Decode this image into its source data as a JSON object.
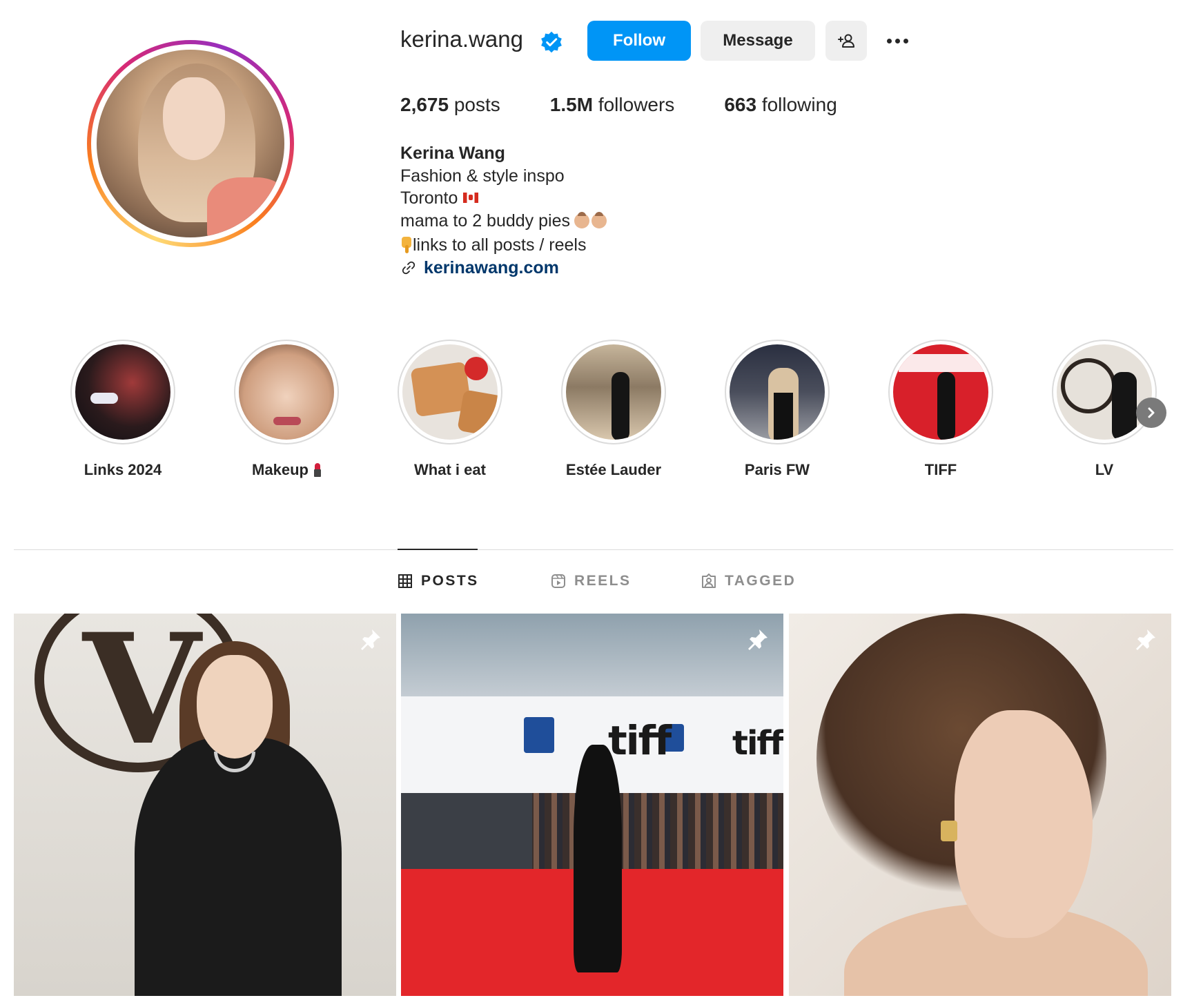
{
  "profile": {
    "username": "kerina.wang",
    "verified_icon": "verified-badge-icon",
    "actions": {
      "follow_label": "Follow",
      "message_label": "Message",
      "add_user_icon": "person-add-icon",
      "more_icon": "more-options-icon"
    },
    "stats": {
      "posts_count": "2,675",
      "posts_label": "posts",
      "followers_count": "1.5M",
      "followers_label": "followers",
      "following_count": "663",
      "following_label": "following"
    },
    "bio": {
      "name": "Kerina Wang",
      "line1": "Fashion & style inspo",
      "line2": "Toronto",
      "line3": "mama to 2 buddy pies",
      "line4": "links to all posts / reels",
      "link": "kerinawang.com"
    }
  },
  "highlights": {
    "items": [
      {
        "label": "Links 2024"
      },
      {
        "label": "Makeup"
      },
      {
        "label": "What i eat"
      },
      {
        "label": "Estée Lauder"
      },
      {
        "label": "Paris FW"
      },
      {
        "label": "TIFF"
      },
      {
        "label": "LV"
      }
    ],
    "next_icon": "chevron-right-icon"
  },
  "tabs": [
    {
      "label": "POSTS",
      "icon": "grid-icon",
      "active": true
    },
    {
      "label": "REELS",
      "icon": "reels-icon",
      "active": false
    },
    {
      "label": "TAGGED",
      "icon": "tagged-icon",
      "active": false
    }
  ],
  "posts": [
    {
      "pinned": true,
      "pin_icon": "pin-icon"
    },
    {
      "pinned": true,
      "pin_icon": "pin-icon"
    },
    {
      "pinned": true,
      "pin_icon": "pin-icon"
    }
  ],
  "colors": {
    "follow_button": "#0095f6",
    "secondary_button": "#efefef",
    "link": "#00376b",
    "verified": "#0095f6",
    "muted_text": "#8e8e8e"
  }
}
